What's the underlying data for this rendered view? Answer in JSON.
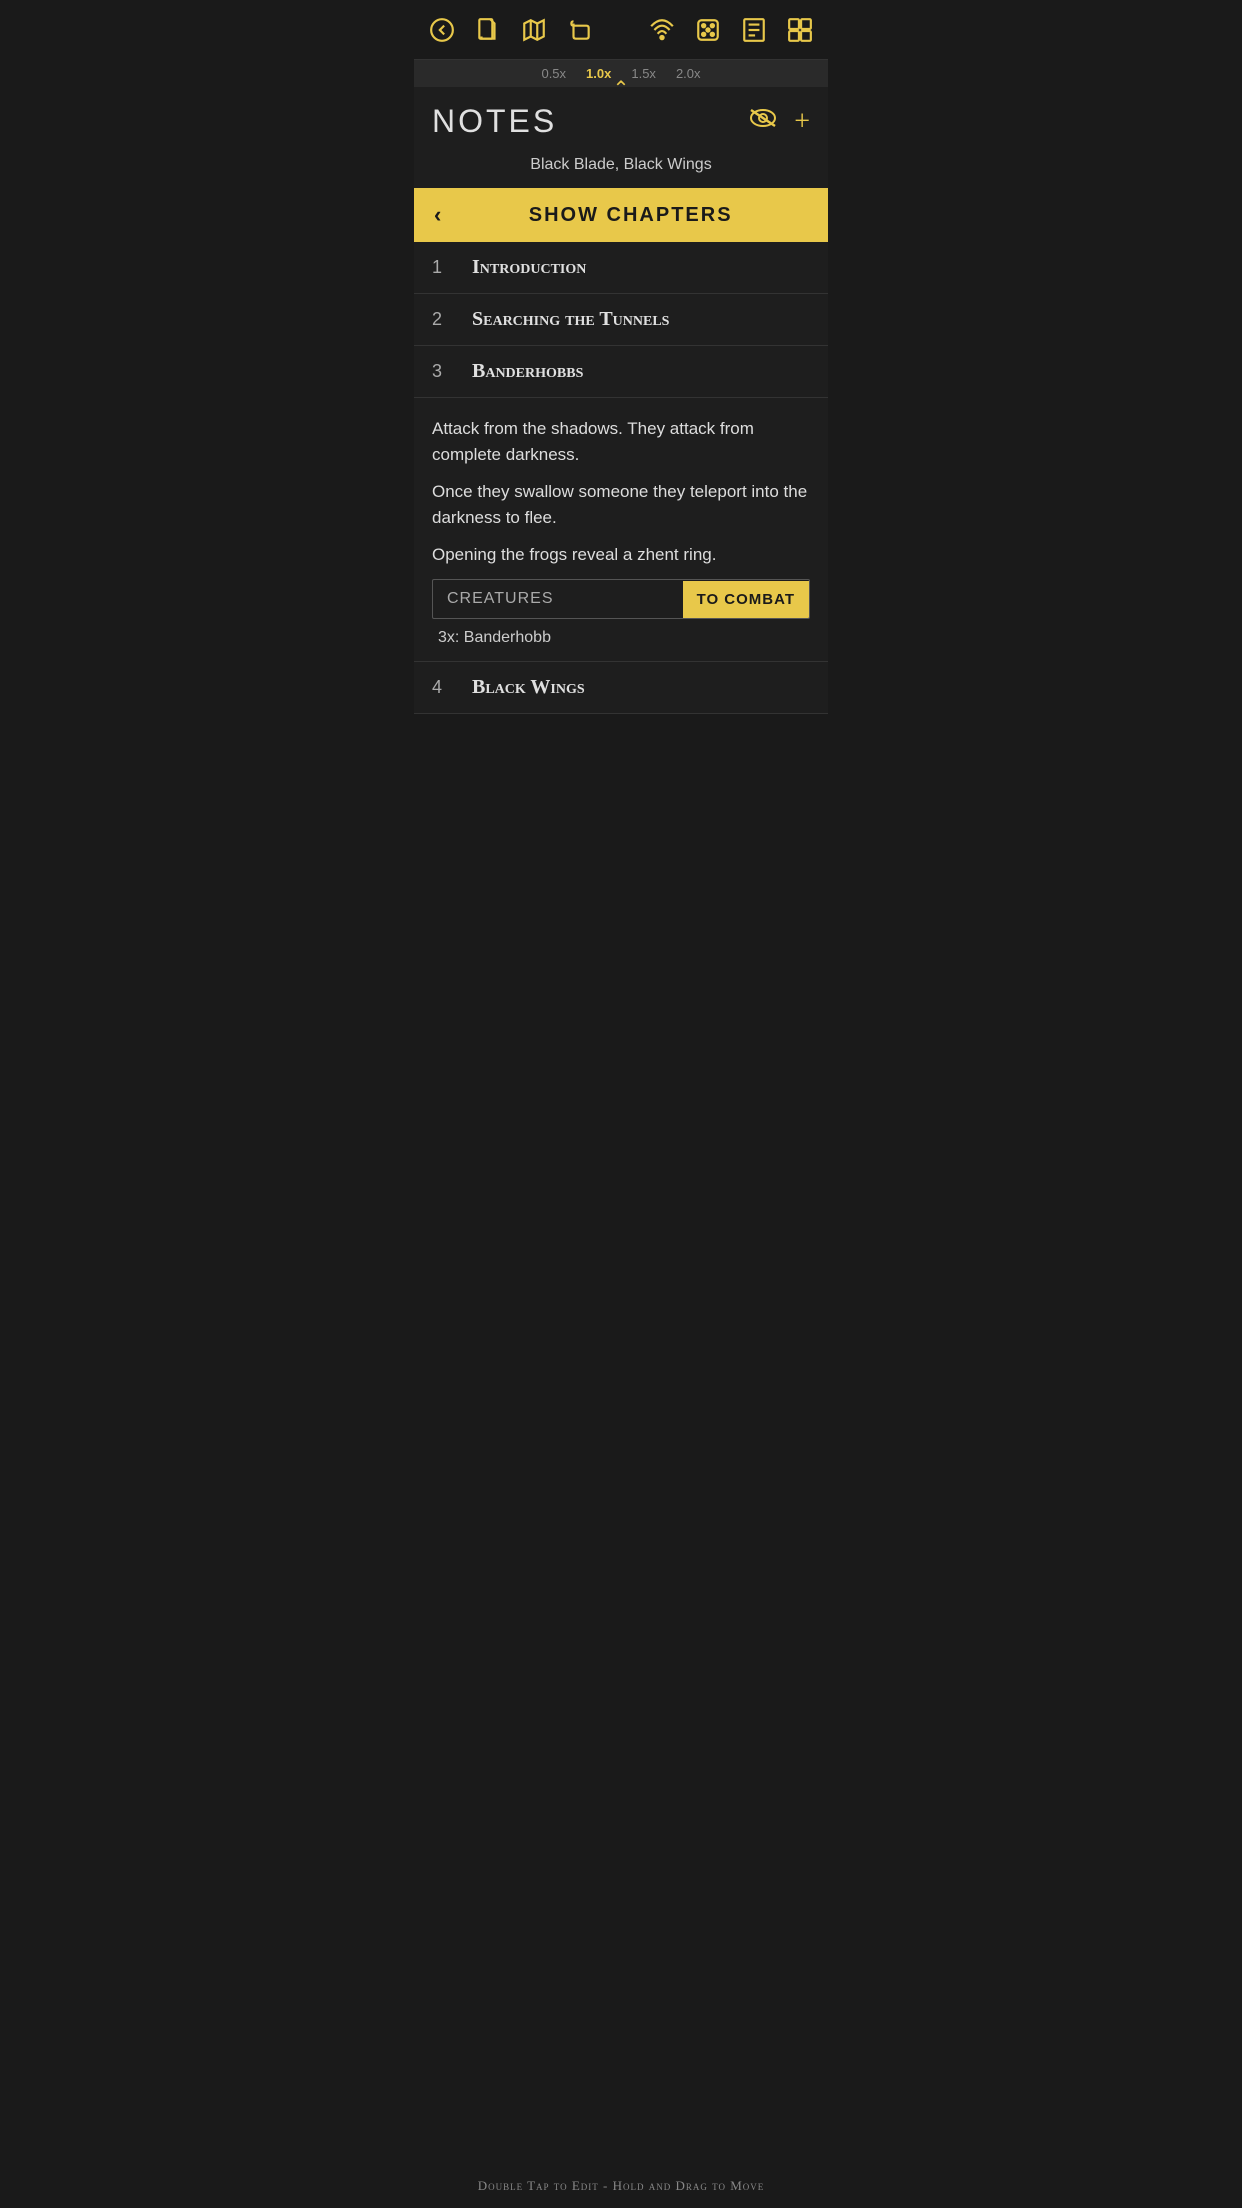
{
  "toolbar": {
    "back_icon": "◀",
    "doc_icon": "doc",
    "map_icon": "map",
    "scroll_icon": "scroll",
    "wifi_icon": "wifi",
    "dice_icon": "dice",
    "list_icon": "list",
    "layout_icon": "layout"
  },
  "zoom": {
    "options": [
      "0.5x",
      "1.0x",
      "1.5x",
      "2.0x"
    ],
    "active_index": 1
  },
  "notes": {
    "title": "NOTES",
    "subtitle": "Black Blade, Black Wings",
    "show_chapters_label": "SHOW CHAPTERS",
    "chapters": [
      {
        "num": "1",
        "name": "Introduction"
      },
      {
        "num": "2",
        "name": "Searching the Tunnels"
      },
      {
        "num": "3",
        "name": "Banderhobbs"
      }
    ],
    "chapter3_notes": [
      "Attack from the shadows. They attack from complete darkness.",
      "Once they swallow someone they teleport into the darkness to flee."
    ],
    "extra_note": "Opening the frogs reveal a zhent ring.",
    "creatures_label": "CREATURES",
    "to_combat_label": "TO COMBAT",
    "creatures_list": "3x: Banderhobb",
    "chapter4": {
      "num": "4",
      "name": "Black Wings"
    }
  },
  "bottom_hint": "Double Tap to Edit - Hold and Drag to Move"
}
